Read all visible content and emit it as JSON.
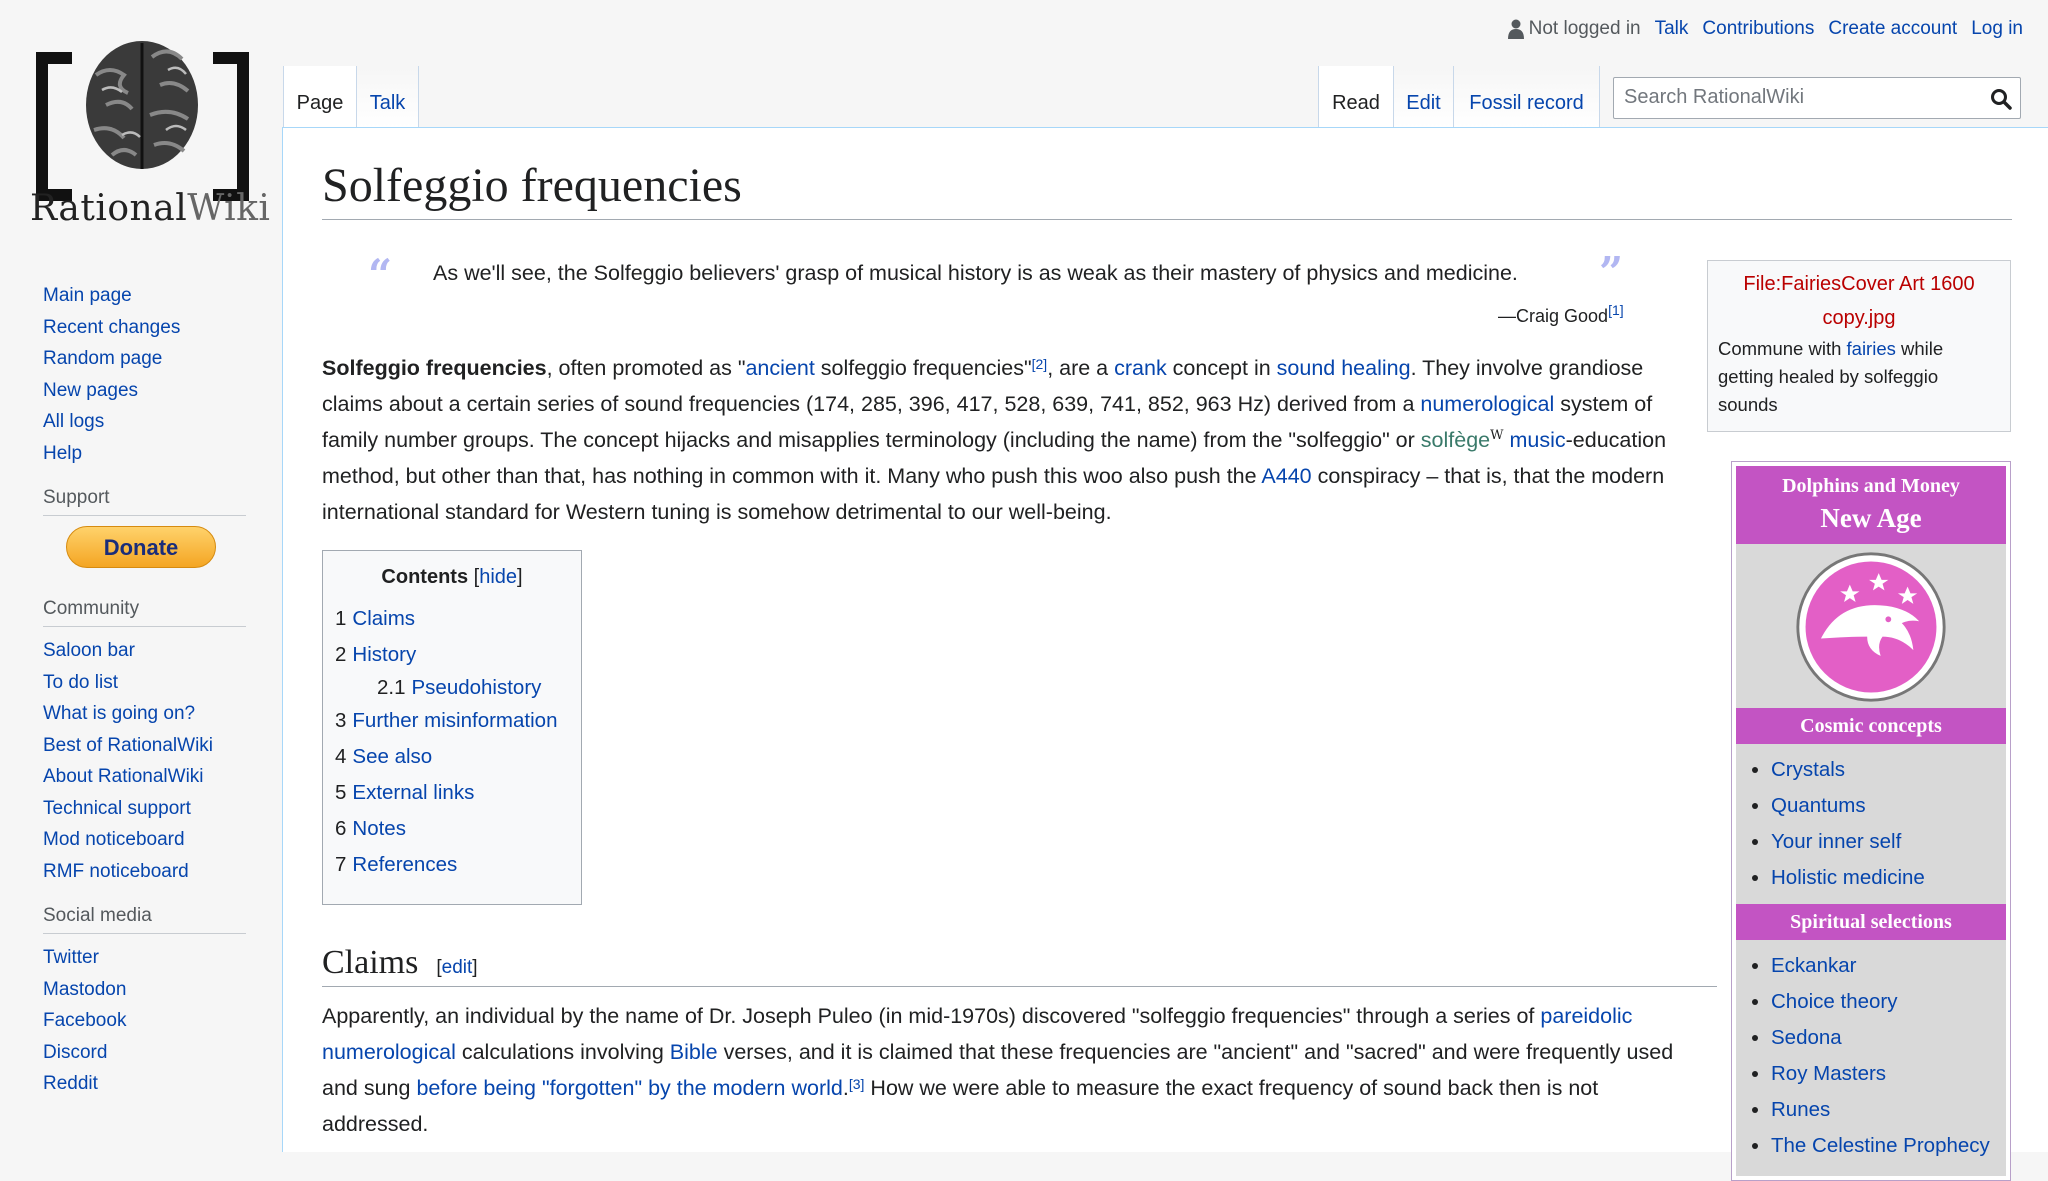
{
  "logo": {
    "word1": "Rational",
    "word2": "Wiki"
  },
  "personal": {
    "not_logged_in": "Not logged in",
    "talk": "Talk",
    "contributions": "Contributions",
    "create_account": "Create account",
    "log_in": "Log in"
  },
  "tabs": {
    "page": "Page",
    "talk": "Talk",
    "read": "Read",
    "edit": "Edit",
    "fossil_record": "Fossil record"
  },
  "search": {
    "placeholder": "Search RationalWiki"
  },
  "sidebar": {
    "nav": [
      "Main page",
      "Recent changes",
      "Random page",
      "New pages",
      "All logs",
      "Help"
    ],
    "support_heading": "Support",
    "donate": "Donate",
    "community_heading": "Community",
    "community": [
      "Saloon bar",
      "To do list",
      "What is going on?",
      "Best of RationalWiki",
      "About RationalWiki",
      "Technical support",
      "Mod noticeboard",
      "RMF noticeboard"
    ],
    "social_heading": "Social media",
    "social": [
      "Twitter",
      "Mastodon",
      "Facebook",
      "Discord",
      "Reddit"
    ]
  },
  "article": {
    "title": "Solfeggio frequencies",
    "quote_open": "“",
    "quote_close": "”",
    "quote": "As we'll see, the Solfeggio believers' grasp of musical history is as weak as their mastery of physics and medicine.",
    "quote_attr": "—Craig Good",
    "quote_ref": "[1]",
    "intro": {
      "bold": "Solfeggio frequencies",
      "t1": ", often promoted as \"",
      "ancient": "ancient",
      "t2": " solfeggio frequencies\"",
      "ref2": "[2]",
      "t3": ", are a ",
      "crank": "crank",
      "t4": " concept in ",
      "sound_healing": "sound healing",
      "t5": ". They involve grandiose claims about a certain series of sound frequencies (174, 285, 396, 417, 528, 639, 741, 852, 963 Hz) derived from a ",
      "numerological": "numerological",
      "t6": " system of family number groups. The concept hijacks and misapplies terminology (including the name) from the \"solfeggio\" or ",
      "solfege": "solfège",
      "w": "W",
      "t7": " ",
      "music": "music",
      "t8": "-education method, but other than that, has nothing in common with it. Many who push this woo also push the ",
      "a440": "A440",
      "t9": " conspiracy – that is, that the modern international standard for Western tuning is somehow detrimental to our well-being."
    },
    "toc": {
      "title": "Contents",
      "hide": "hide",
      "items": [
        {
          "num": "1",
          "label": "Claims"
        },
        {
          "num": "2",
          "label": "History"
        },
        {
          "num": "2.1",
          "label": "Pseudohistory"
        },
        {
          "num": "3",
          "label": "Further misinformation"
        },
        {
          "num": "4",
          "label": "See also"
        },
        {
          "num": "5",
          "label": "External links"
        },
        {
          "num": "6",
          "label": "Notes"
        },
        {
          "num": "7",
          "label": "References"
        }
      ]
    },
    "claims": {
      "heading": "Claims",
      "edit": "edit",
      "t1": "Apparently, an individual by the name of Dr. Joseph Puleo (in mid-1970s) discovered \"solfeggio frequencies\" through a series of ",
      "pareidolic": "pareidolic",
      "t2": " ",
      "numerological": "numerological",
      "t3": " calculations involving ",
      "bible": "Bible",
      "t4": " verses, and it is claimed that these frequencies are \"ancient\" and \"sacred\" and were frequently used and sung ",
      "forgotten": "before being \"forgotten\" by the modern world",
      "t5": ".",
      "ref3": "[3]",
      "t6": " How we were able to measure the exact frequency of sound back then is not addressed."
    }
  },
  "file_box": {
    "title": "File:FairiesCover Art 1600 copy.jpg",
    "caption_t1": "Commune with ",
    "caption_link": "fairies",
    "caption_t2": " while getting healed by solfeggio sounds"
  },
  "navbox": {
    "supertitle": "Dolphins and Money",
    "title": "New Age",
    "cosmic_heading": "Cosmic concepts",
    "cosmic": [
      "Crystals",
      "Quantums",
      "Your inner self",
      "Holistic medicine"
    ],
    "spiritual_heading": "Spiritual selections",
    "spiritual": [
      "Eckankar",
      "Choice theory",
      "Sedona",
      "Roy Masters",
      "Runes",
      "The Celestine Prophecy"
    ]
  },
  "colors": {
    "link": "#0645ad",
    "external": "#36b",
    "navbox_header": "#c354c3",
    "donate": "#f4a523"
  }
}
